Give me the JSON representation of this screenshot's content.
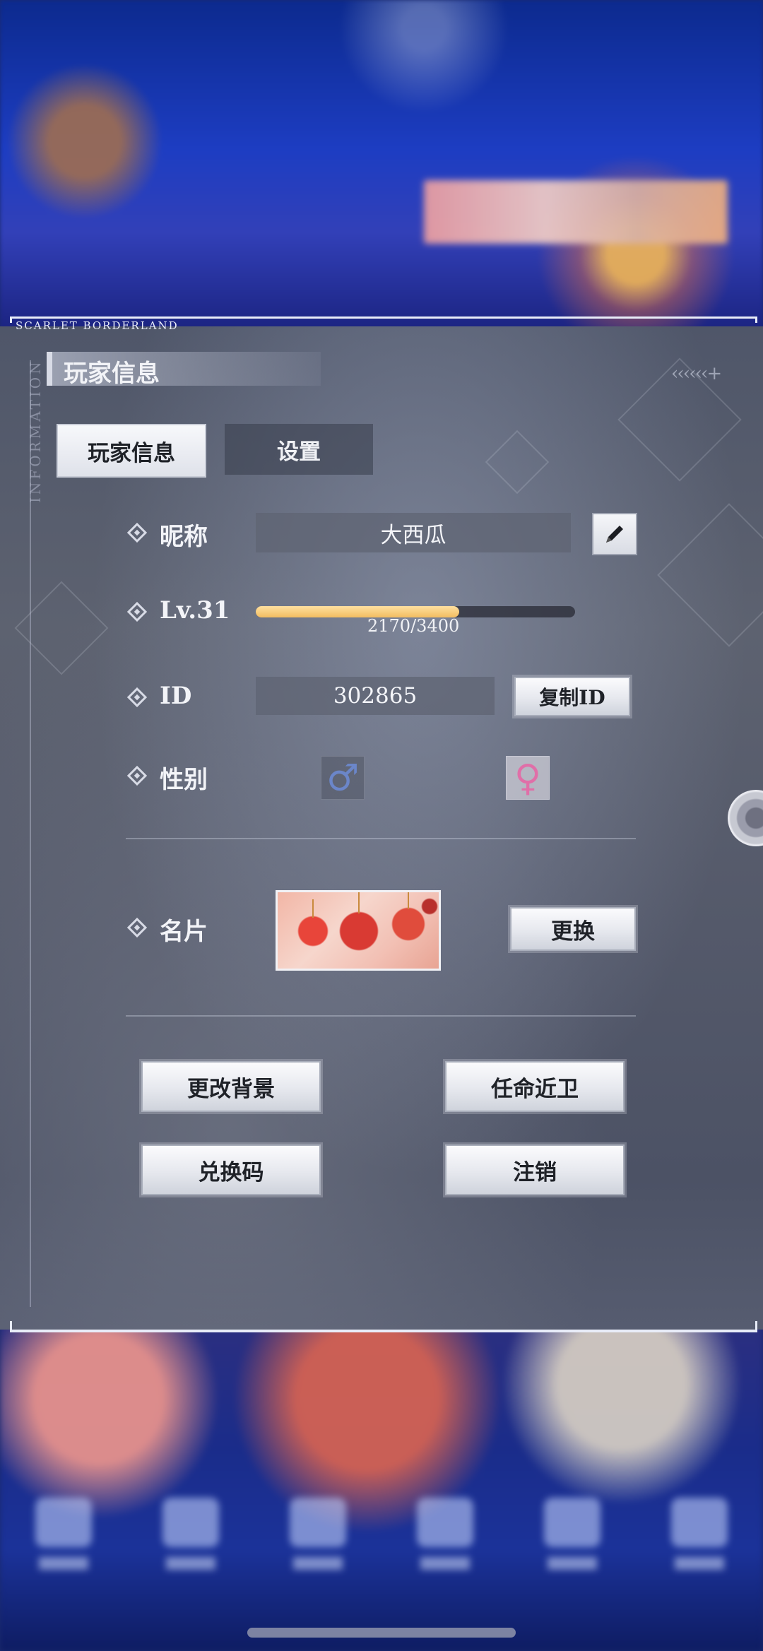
{
  "brand": "SCARLET BORDERLAND",
  "side_label": "INFORMATION",
  "panel_title": "玩家信息",
  "tabs": [
    {
      "label": "玩家信息",
      "active": true
    },
    {
      "label": "设置",
      "active": false
    }
  ],
  "nickname": {
    "label": "昵称",
    "value": "大西瓜"
  },
  "level": {
    "label": "Lv.31",
    "xp_current": 2170,
    "xp_max": 3400,
    "xp_text": "2170/3400"
  },
  "id": {
    "label": "ID",
    "value": "302865",
    "copy_button": "复制ID"
  },
  "gender": {
    "label": "性别",
    "male_symbol": "♂",
    "female_symbol": "♀",
    "selected": "female"
  },
  "card": {
    "label": "名片",
    "change_button": "更换"
  },
  "actions": {
    "change_background": "更改背景",
    "appoint_guard": "任命近卫",
    "redeem_code": "兑换码",
    "logout": "注销"
  },
  "colors": {
    "xp_fill": "#f2bd60",
    "male": "#6b86c9",
    "female": "#e06fa8"
  }
}
